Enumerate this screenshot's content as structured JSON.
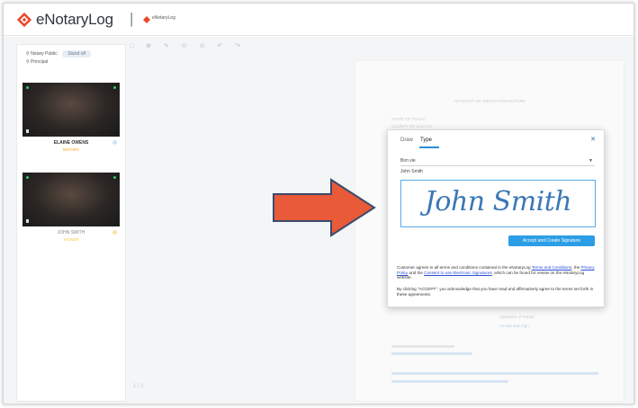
{
  "header": {
    "brand": "eNotaryLog",
    "separator": "|",
    "org_name": "eNotaryLog",
    "brand_color": "#e8492b"
  },
  "participants": {
    "row1_label": "Notary Public",
    "row1_pill": "Stand off",
    "row2_label": "Principal",
    "videos": [
      {
        "name": "ELAINE OWENS",
        "role": "NOTARY"
      },
      {
        "name": "JOHN SMITH",
        "role": "SIGNER"
      }
    ]
  },
  "toolbar": {
    "icons": "□ ⊕ ✎ ⊙ ⊙ ↶ ↷"
  },
  "modal": {
    "tabs": [
      "Draw",
      "Type"
    ],
    "active_tab": "Type",
    "close_icon": "close-icon",
    "font_select": "Bon vie",
    "name_value": "John Smith",
    "signature_text": "John Smith",
    "accept_button": "Accept and Create Signature",
    "legal_1_pre": "Customer agrees to all terms and conditions contained in the eNotaryLog ",
    "legal_1_link1": "Terms and Conditions",
    "legal_1_mid": ", the ",
    "legal_1_link2": "Privacy Policy",
    "legal_1_mid2": " and the ",
    "legal_1_link3": "Consent to use Electronic Signatures",
    "legal_1_post": ", which can be found for review on the eNotaryLog website.",
    "legal_2": "By clicking \"ACCEPT\", you acknowledge that you have read and affirmatively agree to the terms set forth in these agreements."
  },
  "document": {
    "title_faint": "AFFIDAVIT OF IDENTITY/SIGNATURE",
    "line1": "STATE OF TEXAS",
    "line2": "COUNTY OF DALLAS",
    "stamp_label": "NOTARY PUBLIC SEAL",
    "sig_label": "Signature of Notary",
    "link_faint": "Accept and Sign"
  },
  "page_indicator": "1 / 1",
  "colors": {
    "accent": "#2b9ee6",
    "arrow": "#e85a38",
    "signature": "#3a78b5"
  }
}
